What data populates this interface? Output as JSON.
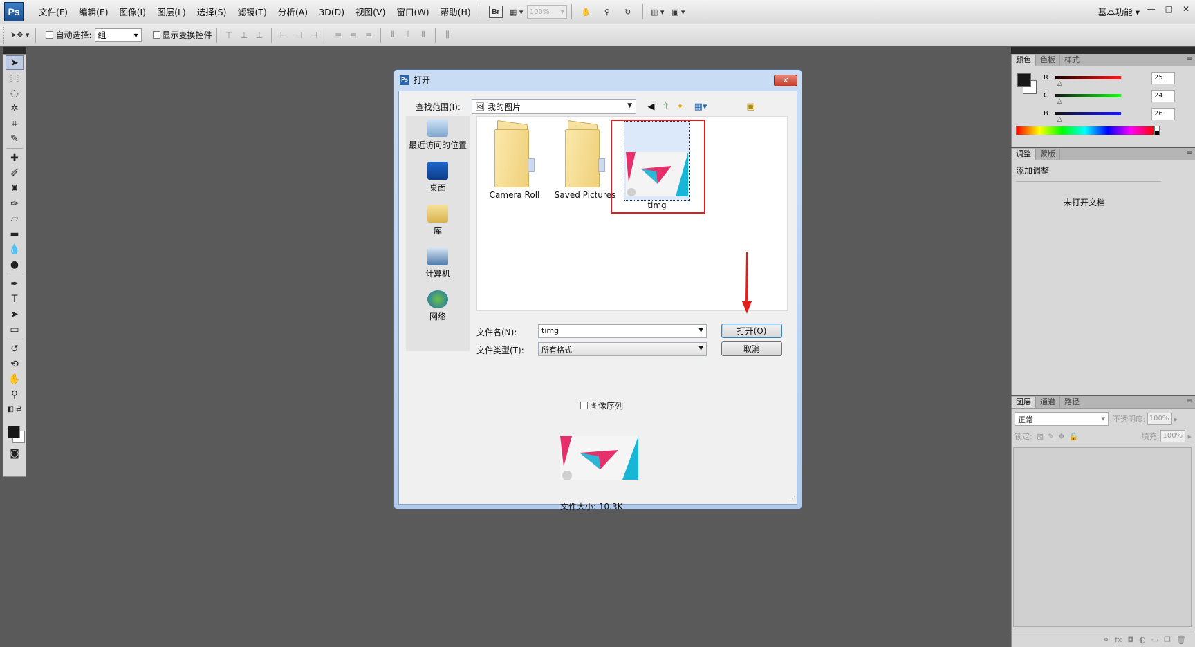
{
  "app": {
    "logo": "Ps",
    "workspace": "基本功能",
    "zoom": "100%",
    "br": "Br"
  },
  "menu": [
    "文件(F)",
    "编辑(E)",
    "图像(I)",
    "图层(L)",
    "选择(S)",
    "滤镜(T)",
    "分析(A)",
    "3D(D)",
    "视图(V)",
    "窗口(W)",
    "帮助(H)"
  ],
  "options": {
    "auto_select": "自动选择:",
    "auto_select_value": "组",
    "show_transform": "显示变换控件"
  },
  "panels": {
    "color": {
      "tabs": [
        "颜色",
        "色板",
        "样式"
      ],
      "r_label": "R",
      "g_label": "G",
      "b_label": "B",
      "r": "25",
      "g": "24",
      "b": "26",
      "fg": "#191819"
    },
    "adjust": {
      "tabs": [
        "调整",
        "蒙版"
      ],
      "title": "添加调整",
      "empty": "未打开文档"
    },
    "layers": {
      "tabs": [
        "图层",
        "通道",
        "路径"
      ],
      "blend": "正常",
      "opacity_label": "不透明度:",
      "opacity": "100%",
      "lock_label": "锁定:",
      "fill_label": "填充:",
      "fill": "100%"
    }
  },
  "dialog": {
    "title": "打开",
    "look_in_label": "查找范围(I):",
    "look_in_value": "我的图片",
    "places": [
      "最近访问的位置",
      "桌面",
      "库",
      "计算机",
      "网络"
    ],
    "files": [
      "Camera Roll",
      "Saved Pictures",
      "timg"
    ],
    "filename_label": "文件名(N):",
    "filename_value": "timg",
    "filetype_label": "文件类型(T):",
    "filetype_value": "所有格式",
    "open_button": "打开(O)",
    "cancel_button": "取消",
    "sequence_label": "图像序列",
    "file_size": "文件大小: 10.3K"
  },
  "colors": {
    "highlight": "#e31d1d",
    "accent": "#2b66ad"
  }
}
